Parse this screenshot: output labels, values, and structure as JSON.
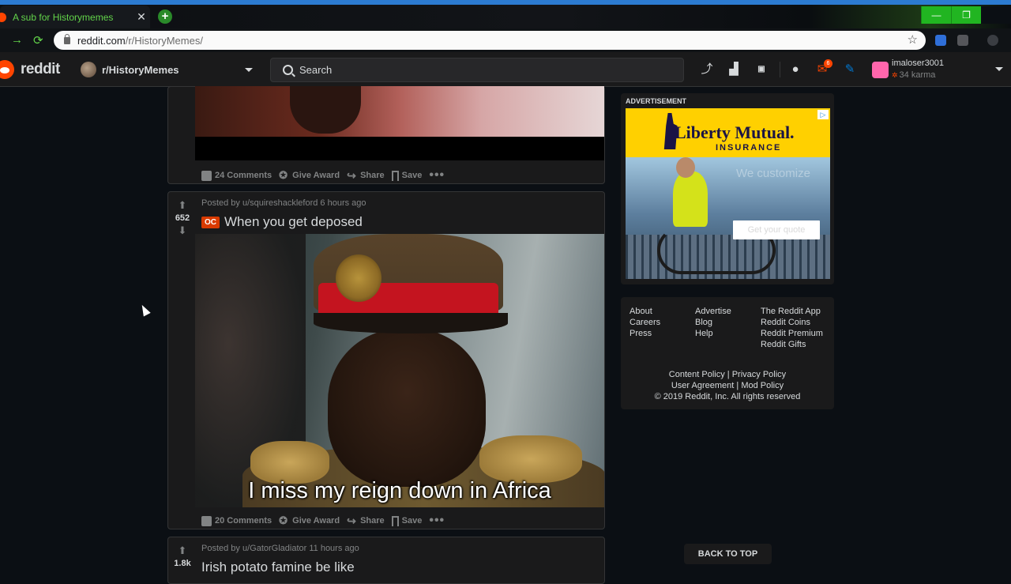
{
  "browser": {
    "tab_title": "A sub for Historymemes",
    "tab_close": "✕",
    "new_tab": "+",
    "url_host": "reddit.com",
    "url_path": "/r/HistoryMemes/",
    "window_buttons": [
      "—",
      "❐",
      ""
    ]
  },
  "header": {
    "logo_text": "reddit",
    "subreddit": "r/HistoryMemes",
    "search_placeholder": "Search",
    "notification_count": "6",
    "username": "imaloser3001",
    "karma": "34 karma"
  },
  "posts": [
    {
      "comments": "24 Comments",
      "give_award": "Give Award",
      "share": "Share",
      "save": "Save",
      "more": "•••"
    },
    {
      "score": "652",
      "byline": "Posted by u/squireshackleford 6 hours ago",
      "flair": "OC",
      "title": "When you get deposed",
      "caption": "I miss my reign down in Africa",
      "comments": "20 Comments",
      "give_award": "Give Award",
      "share": "Share",
      "save": "Save",
      "more": "•••"
    },
    {
      "score": "1.8k",
      "byline": "Posted by u/GatorGladiator 11 hours ago",
      "title": "Irish potato famine be like"
    }
  ],
  "ad": {
    "label": "ADVERTISEMENT",
    "brand": "Liberty Mutual.",
    "brand_sub": "INSURANCE",
    "slogan": "We customize",
    "cta": "Get your quote"
  },
  "footer": {
    "col1": [
      "About",
      "Careers",
      "Press"
    ],
    "col2": [
      "Advertise",
      "Blog",
      "Help"
    ],
    "col3": [
      "The Reddit App",
      "Reddit Coins",
      "Reddit Premium",
      "Reddit Gifts"
    ],
    "content_policy": "Content Policy",
    "privacy_policy": "Privacy Policy",
    "user_agreement": "User Agreement",
    "mod_policy": "Mod Policy",
    "separator": "|",
    "copyright": "© 2019 Reddit, Inc. All rights reserved"
  },
  "back_to_top": "BACK TO TOP",
  "colors": {
    "accent": "#ff4500",
    "background": "#0b0f14",
    "card": "#1a1a1b",
    "tab_text": "#63d44a"
  }
}
